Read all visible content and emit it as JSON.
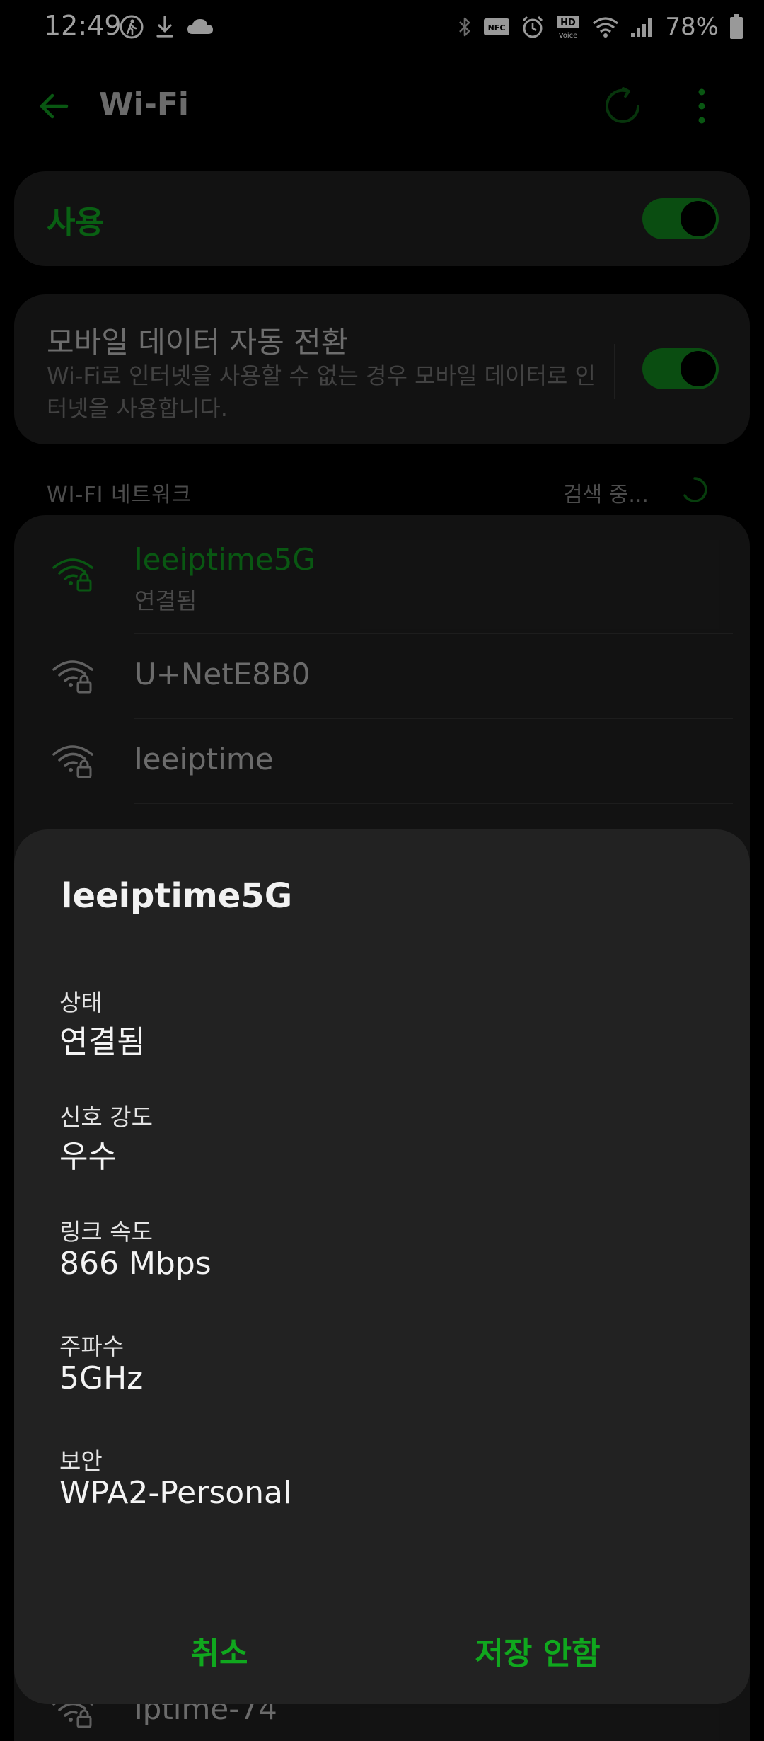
{
  "status_bar": {
    "time": "12:49",
    "battery_percent": "78%",
    "left_icons": [
      "walking-icon",
      "download-icon",
      "cloud-icon"
    ],
    "right_icons": [
      "bluetooth-icon",
      "nfc-icon",
      "alarm-icon",
      "hd-voice-icon",
      "wifi-status-icon",
      "cellular-signal-icon",
      "battery-icon"
    ],
    "nfc_text": "NFC",
    "hd_text": "HD",
    "voice_text": "Voice"
  },
  "app_bar": {
    "title": "Wi-Fi"
  },
  "usage": {
    "label": "사용",
    "toggle_on": true
  },
  "mobile_data_switch": {
    "title": "모바일 데이터 자동 전환",
    "description": "Wi-Fi로 인터넷을 사용할 수 없는 경우 모바일 데이터로 인터넷을 사용합니다.",
    "toggle_on": true
  },
  "networks_section": {
    "label": "WI-FI 네트워크",
    "status": "검색 중..."
  },
  "networks": [
    {
      "name": "leeiptime5G",
      "status": "연결됨",
      "connected": true
    },
    {
      "name": "U+NetE8B0",
      "status": "",
      "connected": false
    },
    {
      "name": "leeiptime",
      "status": "",
      "connected": false
    },
    {
      "name": "iptime-74",
      "status": "",
      "connected": false
    }
  ],
  "dialog": {
    "title": "leeiptime5G",
    "fields": [
      {
        "label": "상태",
        "value": "연결됨"
      },
      {
        "label": "신호 강도",
        "value": "우수"
      },
      {
        "label": "링크 속도",
        "value": "866 Mbps"
      },
      {
        "label": "주파수",
        "value": "5GHz"
      },
      {
        "label": "보안",
        "value": "WPA2-Personal"
      }
    ],
    "cancel_label": "취소",
    "forget_label": "저장 안함"
  },
  "colors": {
    "accent_green": "#10a81e",
    "connected_green": "#0d7d1a",
    "background": "#000000",
    "card": "#1b1b1b",
    "dialog": "#222222"
  }
}
